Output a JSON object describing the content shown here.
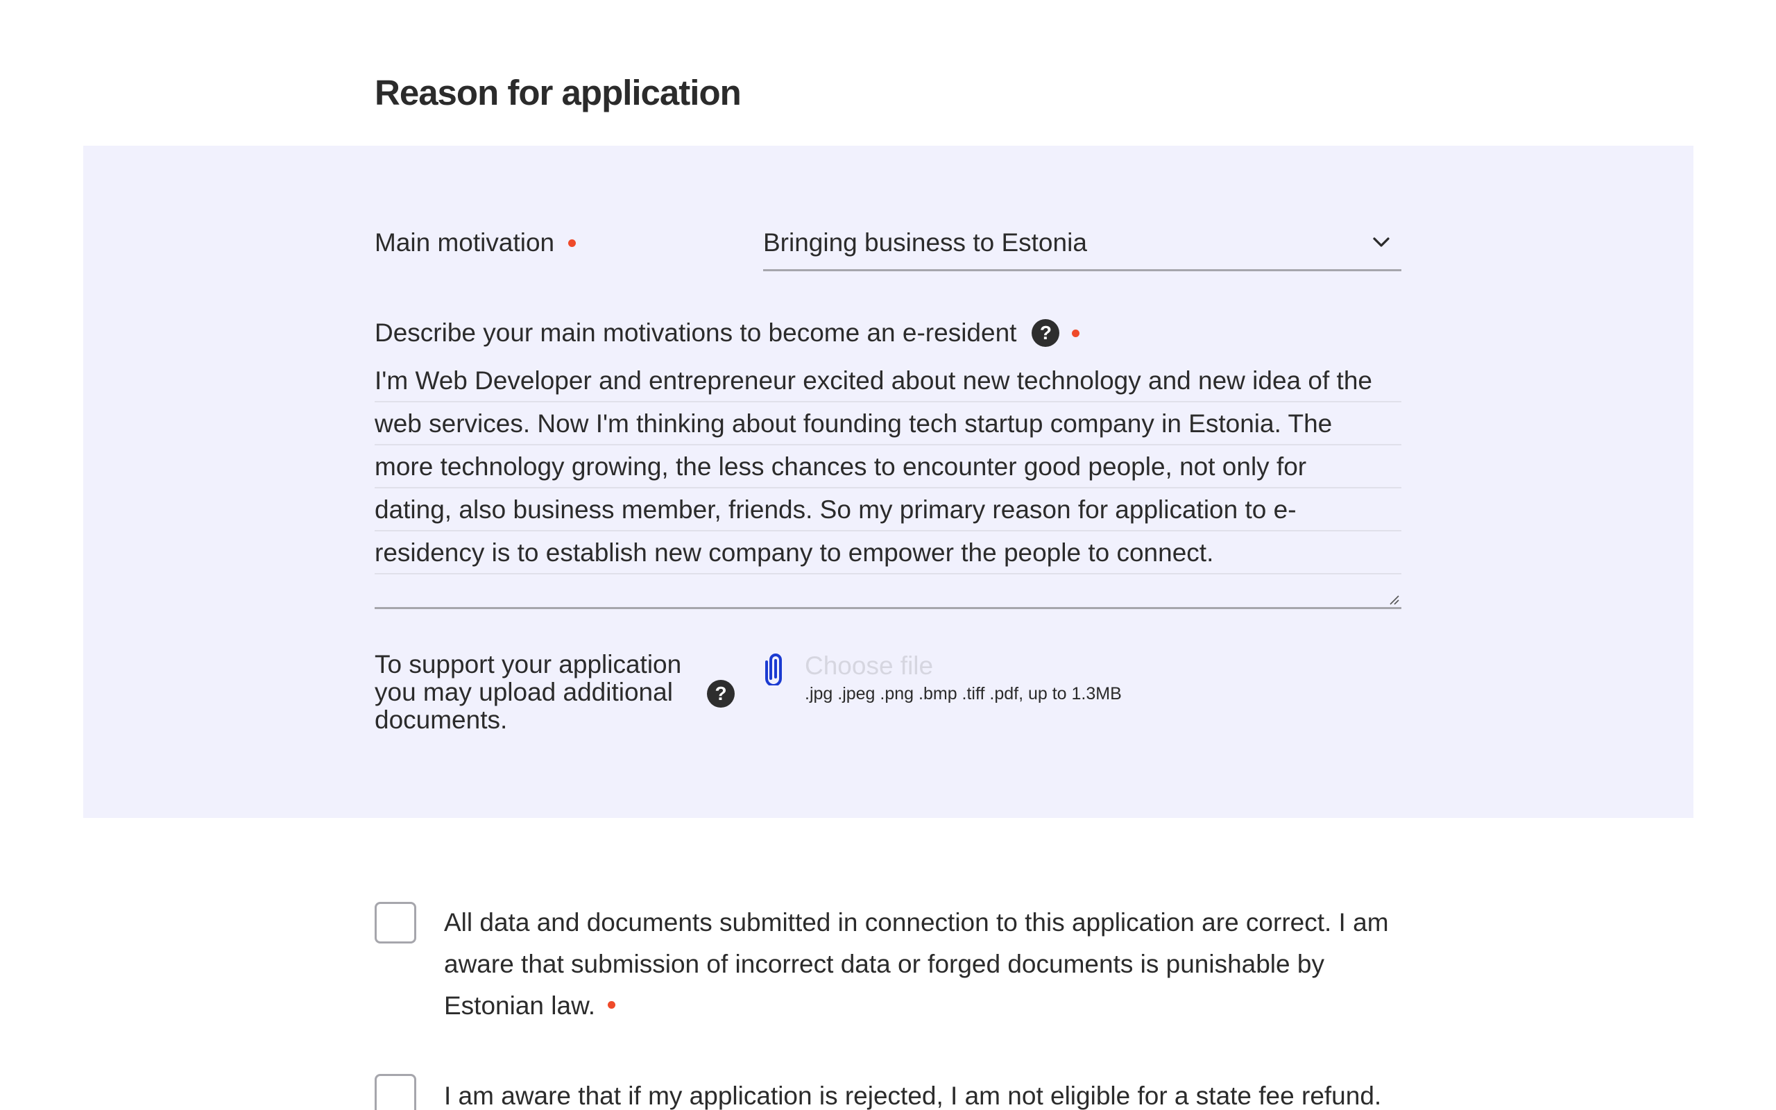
{
  "section": {
    "title": "Reason for application"
  },
  "motivation": {
    "label": "Main motivation",
    "selected": "Bringing business to Estonia"
  },
  "describe": {
    "label": "Describe your main motivations to become an e-resident",
    "help": "?",
    "lines": [
      "I'm Web Developer and entrepreneur excited about new technology and new idea of the",
      "web services. Now I'm thinking about founding tech startup company in Estonia. The",
      "more technology growing, the less chances to encounter good people, not only for",
      "dating, also business member, friends. So my primary reason for application to e-",
      "residency is to establish new company to empower the people to connect."
    ]
  },
  "upload": {
    "label": "To support your application you may upload additional documents.",
    "help": "?",
    "choose_file": "Choose file",
    "hint": ".jpg .jpeg .png .bmp .tiff .pdf, up to 1.3MB"
  },
  "declarations": {
    "correct_data": "All data and documents submitted in connection to this application are correct. I am aware that submission of incorrect data or forged documents is punishable by Estonian law.",
    "no_refund": "I am aware that if my application is rejected, I am not eligible for a state fee refund."
  },
  "colors": {
    "panel_bg": "#f1f1fd",
    "required": "#ef4a2a",
    "attach_icon": "#1b3bd1",
    "underline": "#a6a6ac"
  },
  "icons": {
    "help": "help-circle-icon",
    "attach": "paperclip-icon",
    "dropdown": "chevron-down-icon"
  }
}
